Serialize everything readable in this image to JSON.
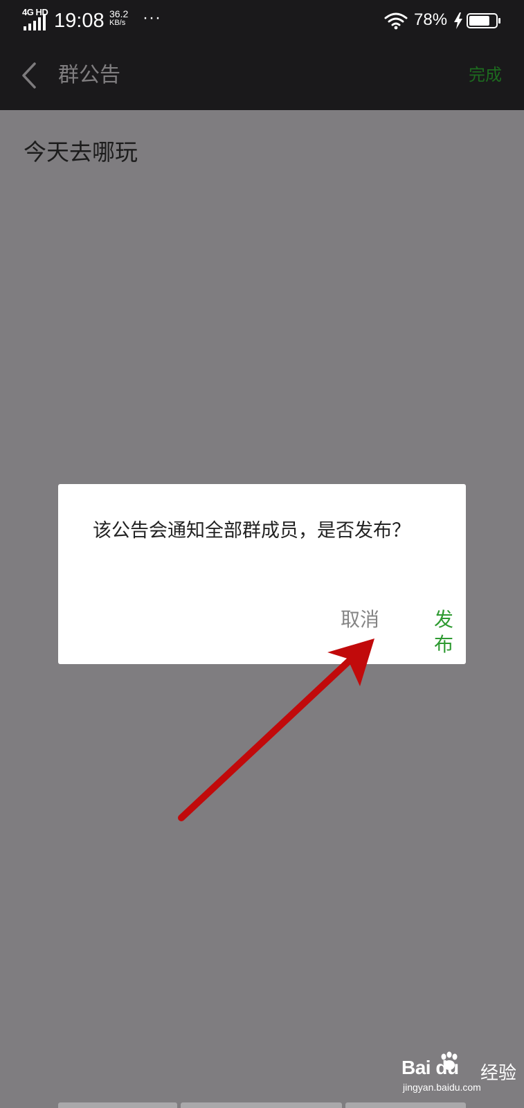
{
  "status_bar": {
    "network": "4G HD",
    "time": "19:08",
    "speed_value": "36.2",
    "speed_unit": "KB/s",
    "more": "···",
    "battery_percent": "78%",
    "battery_level": 0.78,
    "charging": true
  },
  "nav": {
    "title": "群公告",
    "done_label": "完成",
    "back_icon": "chevron-left-icon"
  },
  "content": {
    "text": "今天去哪玩"
  },
  "dialog": {
    "message": "该公告会通知全部群成员，是否发布？",
    "cancel_label": "取消",
    "confirm_label": "发布"
  },
  "annotation": {
    "type": "arrow",
    "color": "#c10a0b",
    "points_to": "confirm-button"
  },
  "watermark": {
    "brand": "Bai du",
    "product": "经验",
    "url": "jingyan.baidu.com"
  },
  "colors": {
    "header_bg": "#1a191b",
    "overlay_bg": "#7f7d80",
    "accent_green": "#2e9a31",
    "cancel_gray": "#848484"
  }
}
